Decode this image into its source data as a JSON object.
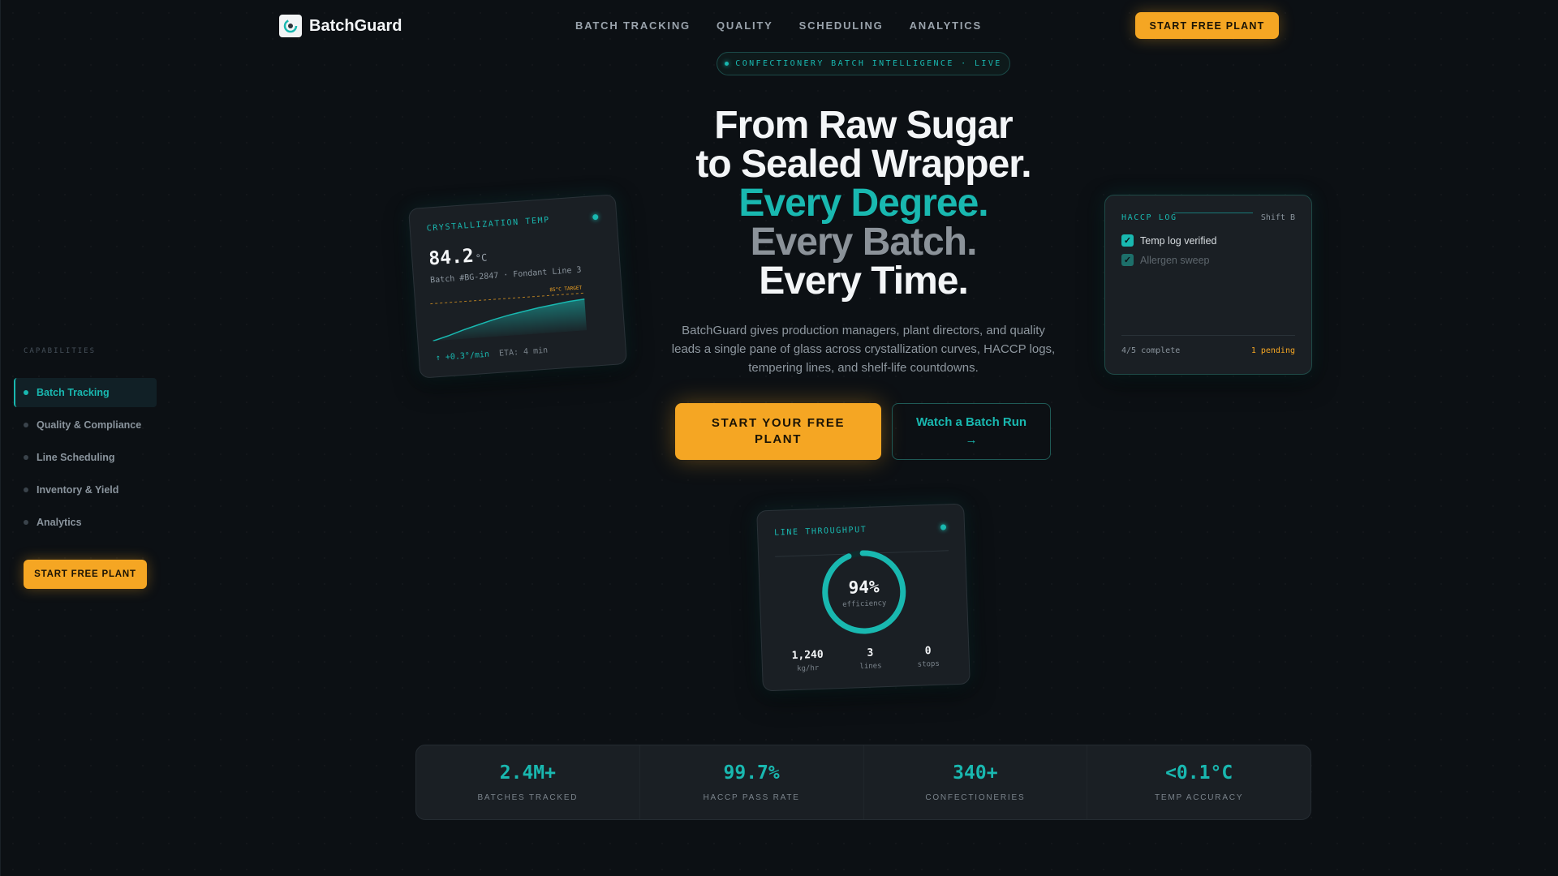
{
  "brand": {
    "name": "BatchGuard",
    "logo_icon": "batchguard-logo-icon"
  },
  "nav": {
    "links": [
      "BATCH TRACKING",
      "QUALITY",
      "SCHEDULING",
      "ANALYTICS"
    ],
    "cta": "START FREE PLANT"
  },
  "sidebar": {
    "heading": "CAPABILITIES",
    "items": [
      {
        "label": "Batch Tracking",
        "active": true
      },
      {
        "label": "Quality & Compliance",
        "active": false
      },
      {
        "label": "Line Scheduling",
        "active": false
      },
      {
        "label": "Inventory & Yield",
        "active": false
      },
      {
        "label": "Analytics",
        "active": false
      }
    ],
    "cta": "START FREE PLANT"
  },
  "hero": {
    "badge": "CONFECTIONERY BATCH INTELLIGENCE · LIVE",
    "headline": [
      "From Raw Sugar",
      "to Sealed Wrapper.",
      "Every Degree.",
      "Every Batch.",
      "Every Time."
    ],
    "subtitle": "BatchGuard gives production managers, plant directors, and quality leads a single pane of glass across crystallization curves, HACCP logs, tempering lines, and shelf-life countdowns.",
    "primary_cta": "START YOUR FREE PLANT",
    "secondary_cta": "Watch a Batch Run →"
  },
  "cards": {
    "crystallization": {
      "title": "CRYSTALLIZATION TEMP",
      "value": "84.2",
      "unit": "°C",
      "batch": "Batch #BG-2847 · Fondant Line 3",
      "rate": "↑ +0.3°/min",
      "eta": "ETA: 4 min",
      "target_label": "85°C TARGET",
      "curve": [
        0.0,
        0.12,
        0.26,
        0.38,
        0.5,
        0.6,
        0.68,
        0.76,
        0.82,
        0.88,
        0.92
      ]
    },
    "haccp": {
      "title": "HACCP LOG",
      "shift": "Shift B",
      "items": [
        "Temp log verified",
        "Allergen sweep"
      ],
      "complete": "4/5 complete",
      "pending": "1 pending"
    },
    "throughput": {
      "title": "LINE THROUGHPUT",
      "percent": "94%",
      "percent_value": 0.94,
      "label": "efficiency",
      "stats": [
        {
          "value": "1,240",
          "unit": "kg/hr"
        },
        {
          "value": "3",
          "unit": "lines"
        },
        {
          "value": "0",
          "unit": "stops"
        }
      ]
    }
  },
  "stats": [
    {
      "value": "2.4M+",
      "label": "BATCHES TRACKED"
    },
    {
      "value": "99.7%",
      "label": "HACCP PASS RATE"
    },
    {
      "value": "340+",
      "label": "CONFECTIONERIES"
    },
    {
      "value": "<0.1°C",
      "label": "TEMP ACCURACY"
    }
  ],
  "colors": {
    "accent": "#19b8b0",
    "cta": "#f5a623",
    "background": "#0c1014",
    "card": "#1a1f24"
  }
}
